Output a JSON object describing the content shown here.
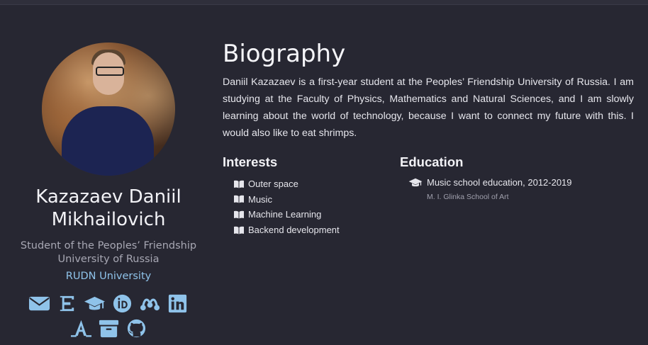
{
  "profile": {
    "name": "Kazazaev Daniil Mikhailovich",
    "position": "Student of the Peoples’ Friendship University of Russia",
    "university": "RUDN University",
    "accent_color": "#8fc3ea",
    "social_icons": [
      "envelope-icon",
      "elibrary-icon",
      "graduation-cap-icon",
      "orcid-icon",
      "mendeley-icon",
      "linkedin-icon",
      "academia-icon",
      "archive-icon",
      "github-icon"
    ]
  },
  "biography": {
    "title": "Biography",
    "text": "Daniil Kazazaev is a first-year student at the Peoples’ Friendship University of Russia. I am studying at the Faculty of Physics, Mathematics and Natural Sciences, and I am slowly learning about the world of technology, because I want to connect my future with this. I would also like to eat shrimps."
  },
  "interests": {
    "title": "Interests",
    "items": [
      "Outer space",
      "Music",
      "Machine Learning",
      "Backend development"
    ]
  },
  "education": {
    "title": "Education",
    "courses": [
      {
        "course": "Music school education, 2012-2019",
        "institution": "M. I. Glinka School of Art"
      }
    ]
  },
  "colors": {
    "background": "#272732",
    "text": "#e8e8ee",
    "muted": "#a7a7b3",
    "link": "#8fc3ea"
  }
}
